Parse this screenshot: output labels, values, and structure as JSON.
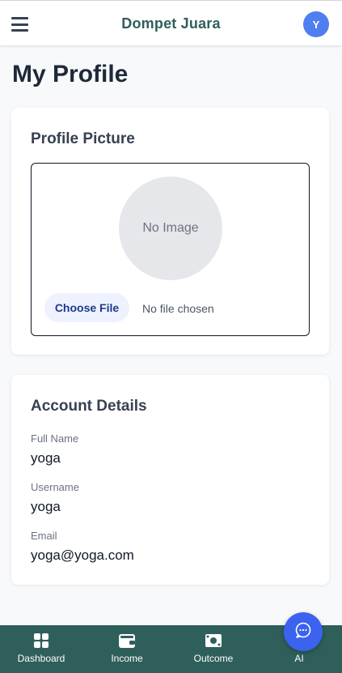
{
  "header": {
    "app_title": "Dompet Juara",
    "avatar_initial": "Y",
    "menu_icon": "hamburger-icon"
  },
  "page": {
    "title": "My Profile"
  },
  "profile_picture": {
    "title": "Profile Picture",
    "placeholder_text": "No Image",
    "choose_file_label": "Choose File",
    "file_status": "No file chosen"
  },
  "account_details": {
    "title": "Account Details",
    "fields": [
      {
        "label": "Full Name",
        "value": "yoga"
      },
      {
        "label": "Username",
        "value": "yoga"
      },
      {
        "label": "Email",
        "value": "yoga@yoga.com"
      }
    ]
  },
  "bottom_nav": {
    "items": [
      {
        "label": "Dashboard",
        "icon": "grid-icon"
      },
      {
        "label": "Income",
        "icon": "wallet-icon"
      },
      {
        "label": "Outcome",
        "icon": "cash-icon"
      },
      {
        "label": "AI",
        "icon": "chat-bubble-icon"
      }
    ]
  },
  "colors": {
    "brand": "#2f5f5a",
    "avatar": "#4f7ef0",
    "fab": "#3b63f0"
  }
}
